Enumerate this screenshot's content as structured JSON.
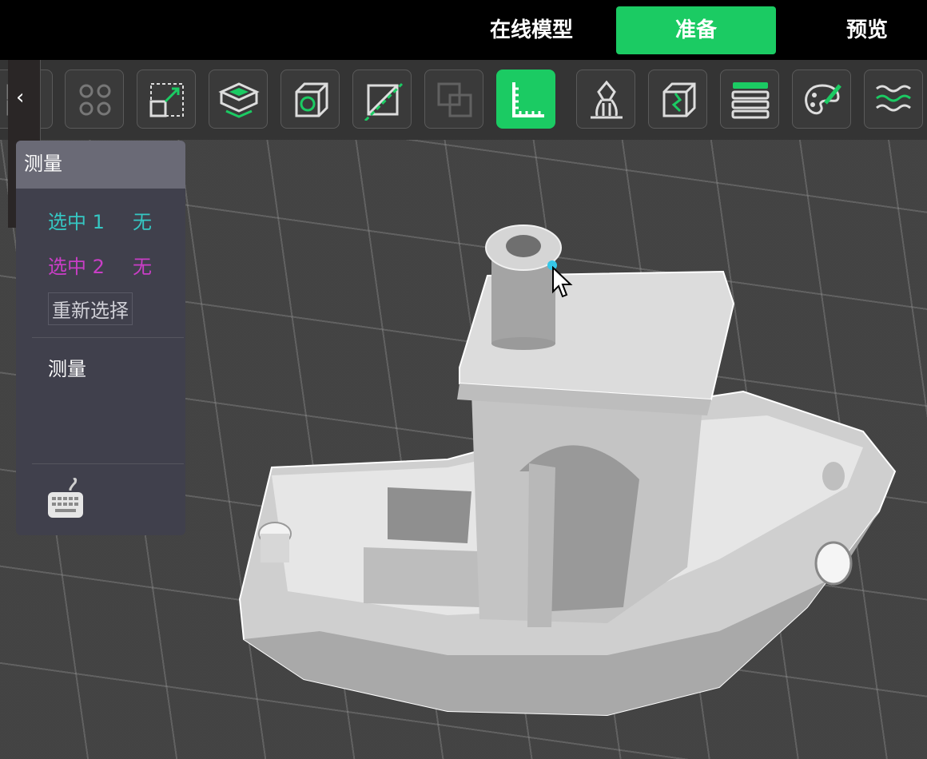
{
  "topbar": {
    "nav": [
      {
        "label": "在线模型",
        "active": false
      },
      {
        "label": "准备",
        "active": true
      },
      {
        "label": "预览",
        "active": false
      }
    ]
  },
  "toolbar": {
    "tools": [
      {
        "icon": "arrange-icon",
        "active": false,
        "enabled": true
      },
      {
        "icon": "distribute-gear-icon",
        "active": false,
        "enabled": true
      },
      {
        "icon": "scale-icon",
        "active": false,
        "enabled": true
      },
      {
        "icon": "lay-flat-icon",
        "active": false,
        "enabled": true
      },
      {
        "icon": "hollow-cube-icon",
        "active": false,
        "enabled": true
      },
      {
        "icon": "cut-icon",
        "active": false,
        "enabled": true
      },
      {
        "icon": "boolean-icon",
        "active": false,
        "enabled": false
      },
      {
        "icon": "measure-ruler-icon",
        "active": true,
        "enabled": true
      },
      {
        "icon": "support-icon",
        "active": false,
        "enabled": true
      },
      {
        "icon": "split-icon",
        "active": false,
        "enabled": true
      },
      {
        "icon": "layer-icon",
        "active": false,
        "enabled": true
      },
      {
        "icon": "paint-icon",
        "active": false,
        "enabled": true
      },
      {
        "icon": "fuzzy-skin-icon",
        "active": false,
        "enabled": true
      }
    ]
  },
  "panel": {
    "title": "测量",
    "selection1": {
      "label": "选中 1",
      "value": "无",
      "color": "#35c7c3"
    },
    "selection2": {
      "label": "选中 2",
      "value": "无",
      "color": "#c93ec6"
    },
    "reselect_label": "重新选择",
    "measure_label": "测量"
  },
  "colors": {
    "accent": "#1bcb63",
    "background": "#4b4b4b",
    "model": "#d9d9d9",
    "pick_point": "#35c7e8"
  }
}
